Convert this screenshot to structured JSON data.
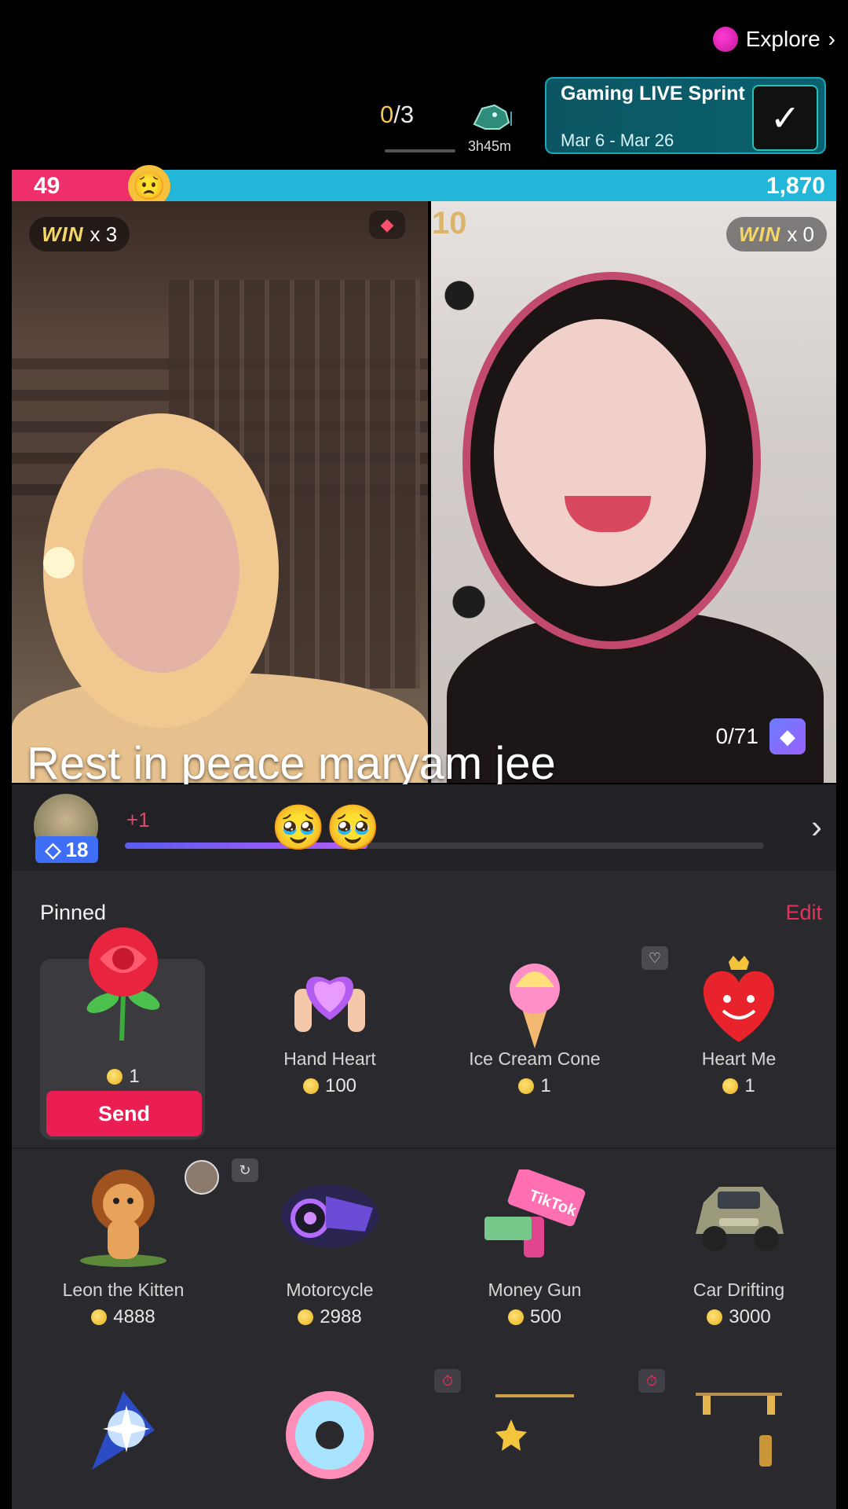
{
  "header": {
    "explore_label": "Explore",
    "explore_chevron": "›",
    "win_count_done": "0",
    "win_count_total": "/3",
    "timer": "3h45m",
    "sprint_title": "Gaming LIVE Sprint",
    "sprint_dates": "Mar 6 - Mar 26"
  },
  "battle": {
    "score_left": "49",
    "score_right": "1,870",
    "score_left_fraction": 0.026,
    "left_wins_label": "WIN",
    "left_wins_value": "x 3",
    "right_wins_label": "WIN",
    "right_wins_value": "x 0",
    "faded_number": "10",
    "right_counter": "0/71"
  },
  "caption": "Rest in peace maryam jee",
  "level": {
    "badge": "18",
    "plus": "+1",
    "progress_fraction": 0.38,
    "emojis": "🥹🥹",
    "arrow": "›"
  },
  "gifts_panel": {
    "pinned_label": "Pinned",
    "edit_label": "Edit",
    "send_label": "Send",
    "pinned": [
      {
        "name": "",
        "price": "1",
        "icon": "rose"
      },
      {
        "name": "Hand Heart",
        "price": "100",
        "icon": "hand-heart"
      },
      {
        "name": "Ice Cream Cone",
        "price": "1",
        "icon": "ice-cream"
      },
      {
        "name": "Heart Me",
        "price": "1",
        "icon": "heart-me"
      }
    ],
    "row2": [
      {
        "name": "Leon the Kitten",
        "price": "4888",
        "icon": "lion"
      },
      {
        "name": "Motorcycle",
        "price": "2988",
        "icon": "motorcycle"
      },
      {
        "name": "Money Gun",
        "price": "500",
        "icon": "money-gun",
        "art_text": "TikTok"
      },
      {
        "name": "Car Drifting",
        "price": "3000",
        "icon": "car"
      }
    ],
    "row3": [
      {
        "icon": "galaxy"
      },
      {
        "icon": "doughnut"
      },
      {
        "icon": "crescent-chain"
      },
      {
        "icon": "crescent-lantern"
      }
    ]
  },
  "colors": {
    "score_left": "#ee2f6c",
    "score_right": "#22b6d9",
    "send": "#ea1e52",
    "edit": "#e8305d"
  }
}
